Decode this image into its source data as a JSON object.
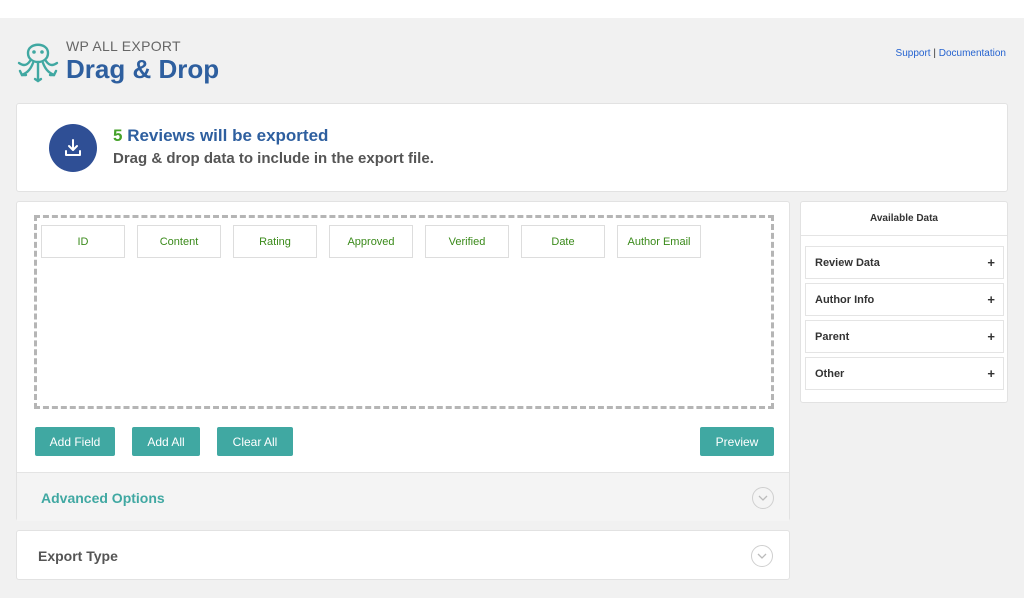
{
  "brand": {
    "top": "WP ALL EXPORT",
    "main": "Drag & Drop"
  },
  "toplinks": {
    "support": "Support",
    "separator": " | ",
    "documentation": "Documentation"
  },
  "summary": {
    "count": "5",
    "headline_rest": " Reviews will be exported",
    "subtitle": "Drag & drop data to include in the export file.",
    "icon": "download-icon"
  },
  "fields": [
    "ID",
    "Content",
    "Rating",
    "Approved",
    "Verified",
    "Date",
    "Author Email"
  ],
  "buttons": {
    "add_field": "Add Field",
    "add_all": "Add All",
    "clear_all": "Clear All",
    "preview": "Preview"
  },
  "advanced_options": {
    "label": "Advanced Options",
    "icon": "chevron-down-icon"
  },
  "export_type": {
    "label": "Export Type",
    "icon": "chevron-down-icon"
  },
  "available_data": {
    "title": "Available Data",
    "sections": [
      {
        "label": "Review Data",
        "icon": "+"
      },
      {
        "label": "Author Info",
        "icon": "+"
      },
      {
        "label": "Parent",
        "icon": "+"
      },
      {
        "label": "Other",
        "icon": "+"
      }
    ]
  },
  "colors": {
    "accent": "#40a8a2",
    "brand": "#2e5f9f",
    "count_green": "#46a22b",
    "field_green": "#3a8a1a"
  }
}
